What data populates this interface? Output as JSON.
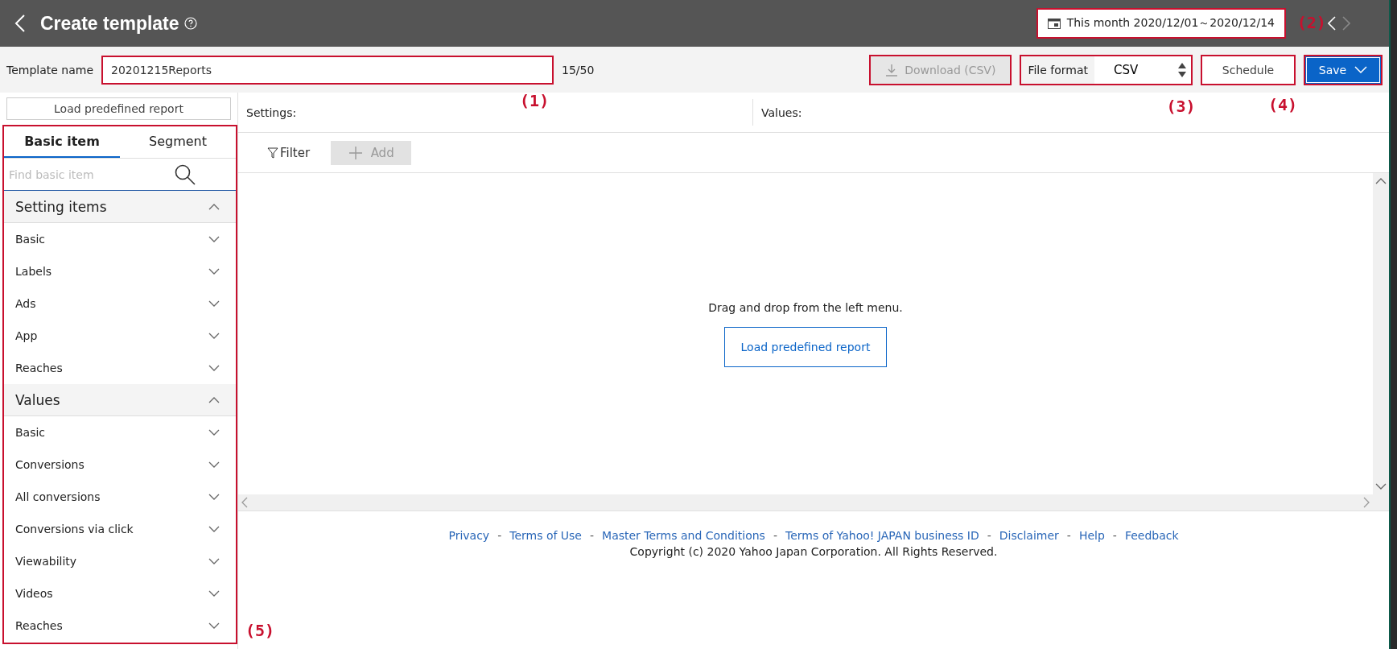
{
  "header": {
    "title": "Create template",
    "date_range": {
      "text": "This month 2020/12/01～2020/12/14",
      "annotation": "(2)"
    }
  },
  "template_row": {
    "label": "Template name",
    "value": "20201215Reports",
    "count": "15/50",
    "annotation": "(1)",
    "download": {
      "label": "Download (CSV)",
      "disabled": true
    },
    "file_format": {
      "label": "File format",
      "value": "CSV",
      "annotation": "(3)"
    },
    "schedule": {
      "label": "Schedule",
      "annotation": "(4)"
    },
    "save": {
      "label": "Save"
    }
  },
  "left_panel": {
    "load_button": "Load predefined report",
    "annotation": "(5)",
    "tabs": [
      {
        "label": "Basic item",
        "selected": true
      },
      {
        "label": "Segment",
        "selected": false
      }
    ],
    "search": {
      "placeholder": "Find basic item"
    },
    "sections": [
      {
        "title": "Setting items",
        "expanded": true,
        "items": [
          "Basic",
          "Labels",
          "Ads",
          "App",
          "Reaches"
        ]
      },
      {
        "title": "Values",
        "expanded": true,
        "items": [
          "Basic",
          "Conversions",
          "All conversions",
          "Conversions via click",
          "Viewability",
          "Videos",
          "Reaches"
        ]
      }
    ]
  },
  "main": {
    "settings_label": "Settings:",
    "values_label": "Values:",
    "filter": "Filter",
    "add": {
      "label": "Add",
      "disabled": true
    },
    "empty_text": "Drag and drop from the left menu.",
    "load_button": "Load predefined report"
  },
  "footer": {
    "links": [
      "Privacy",
      "Terms of Use",
      "Master Terms and Conditions",
      "Terms of Yahoo! JAPAN business ID",
      "Disclaimer",
      "Help",
      "Feedback"
    ],
    "separator": "-",
    "copyright": "Copyright (c) 2020 Yahoo Japan Corporation. All Rights Reserved."
  }
}
